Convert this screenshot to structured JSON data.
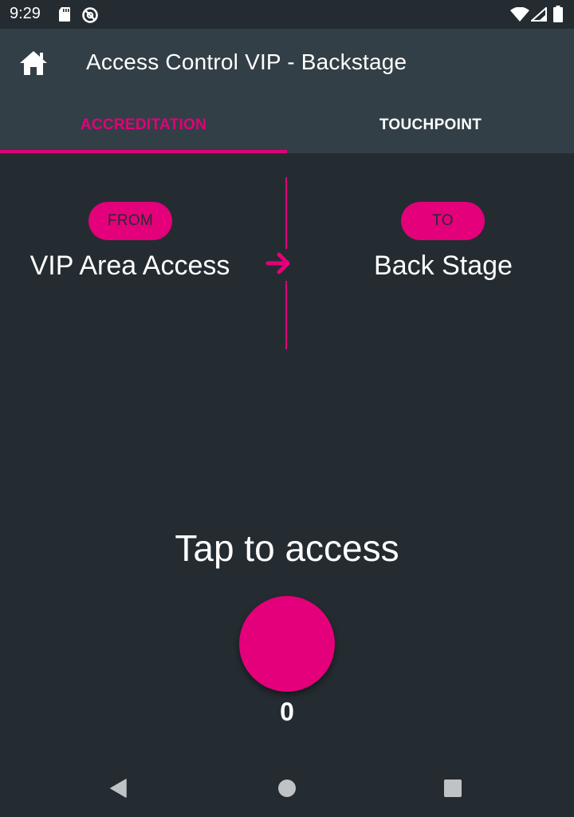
{
  "status_bar": {
    "time": "9:29",
    "icons": [
      "sd-card-icon",
      "no-sync-icon",
      "wifi-icon",
      "signal-icon",
      "battery-icon"
    ]
  },
  "app_bar": {
    "title": "Access Control VIP - Backstage",
    "home_icon": "home-icon"
  },
  "tabs": [
    {
      "label": "ACCREDITATION",
      "active": true
    },
    {
      "label": "TOUCHPOINT",
      "active": false
    }
  ],
  "route": {
    "from_label": "FROM",
    "from_value": "VIP Area Access",
    "to_label": "TO",
    "to_value": "Back Stage",
    "arrow_icon": "arrow-right-icon"
  },
  "tap": {
    "label": "Tap to access",
    "count": "0"
  },
  "navigation": {
    "icons": [
      "back-icon",
      "home-circle-icon",
      "recents-icon"
    ]
  },
  "colors": {
    "accent": "#e3007a",
    "background": "#242c31",
    "app_bar": "#333f46",
    "text": "#ffffff"
  }
}
